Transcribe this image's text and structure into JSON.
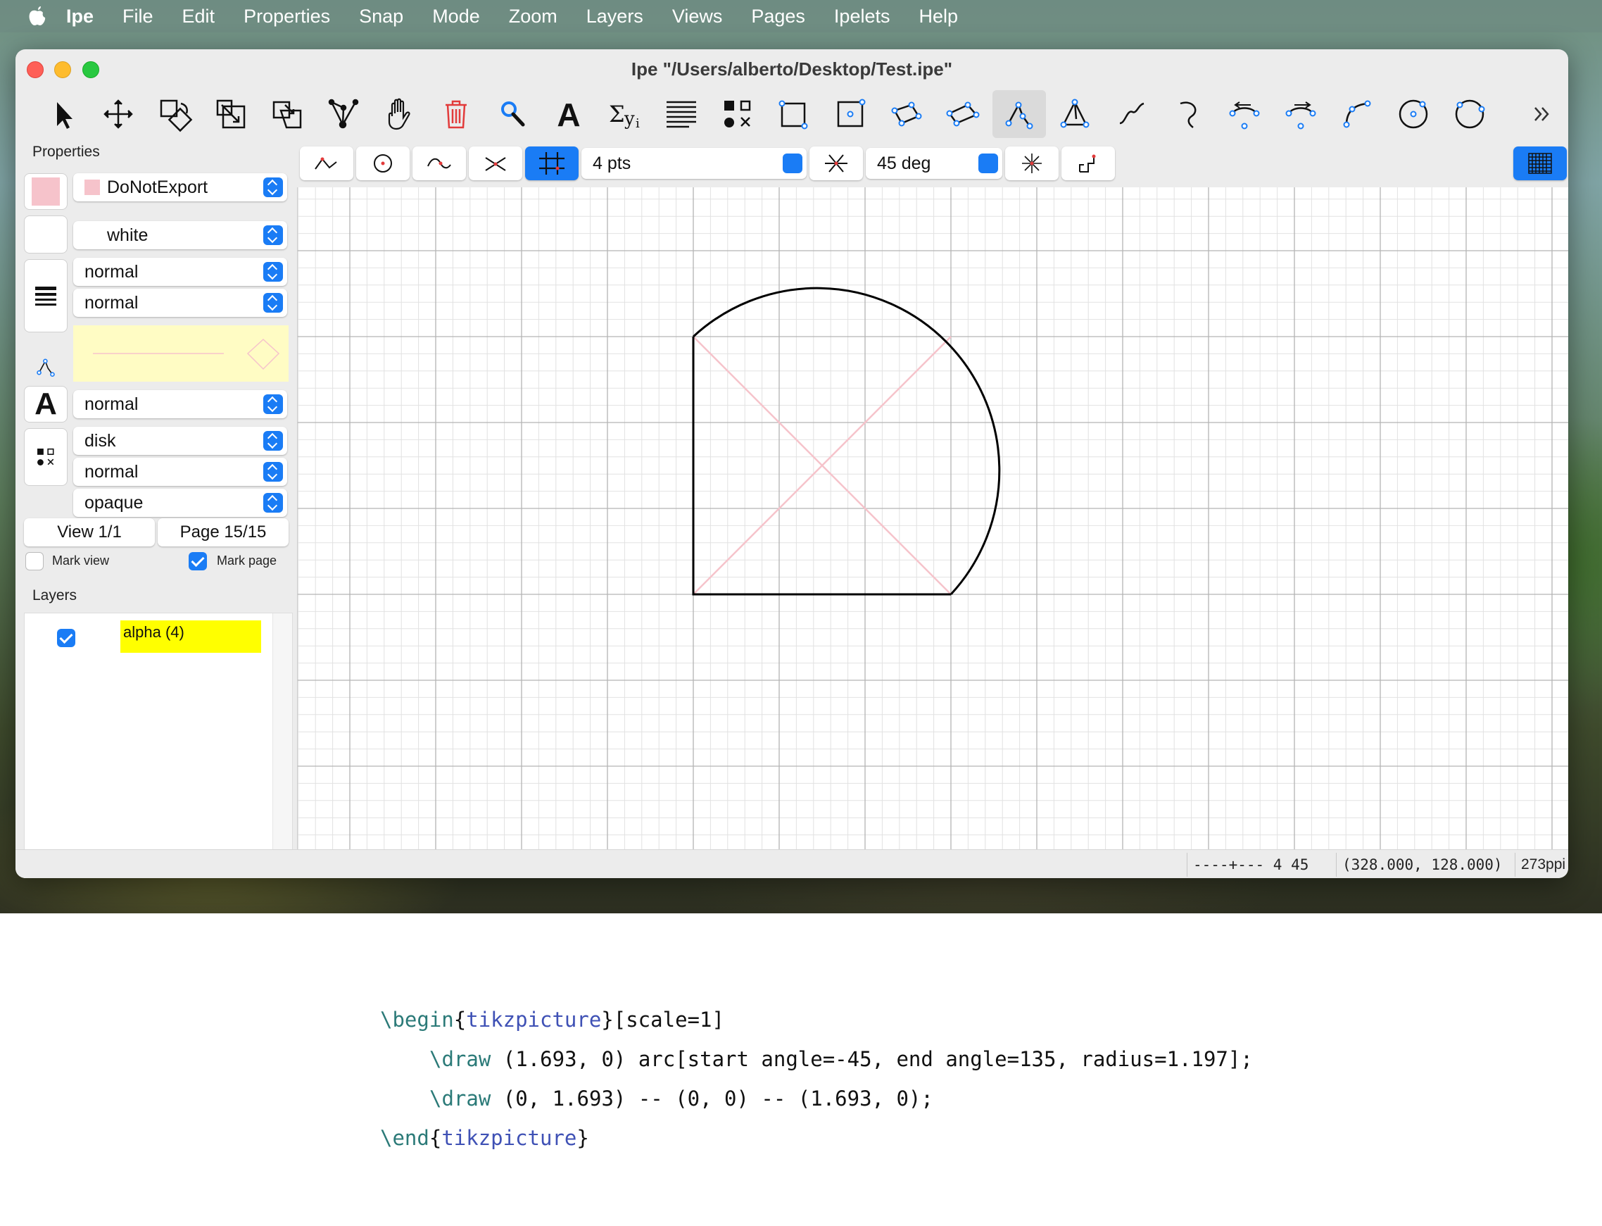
{
  "menubar": {
    "app": "Ipe",
    "items": [
      "File",
      "Edit",
      "Properties",
      "Snap",
      "Mode",
      "Zoom",
      "Layers",
      "Views",
      "Pages",
      "Ipelets",
      "Help"
    ]
  },
  "window": {
    "title": "Ipe \"/Users/alberto/Desktop/Test.ipe\""
  },
  "toolbar": {
    "tools": [
      "select-icon",
      "translate-icon",
      "rotate-icon",
      "stretch-icon",
      "shear-icon",
      "graph-icon",
      "pan-icon",
      "delete-icon",
      "magnify-icon",
      "text-label-icon",
      "math-formula-icon",
      "paragraph-icon",
      "marks-icon",
      "rectangle-icon",
      "box-icon",
      "parallelogram-icon",
      "splinegon-icon",
      "polyline-icon",
      "polygon-icon",
      "spline-icon",
      "bezier-icon",
      "arc-cw-icon",
      "arc-ccw-icon",
      "arc-3pt-icon",
      "circle-center-icon",
      "circle-3pt-icon",
      "more-icon"
    ],
    "active": "polyline-icon"
  },
  "properties": {
    "title": "Properties",
    "stroke": {
      "label": "DoNotExport",
      "color": "#f6c3cb"
    },
    "fill": {
      "label": "white",
      "color": "#ffffff"
    },
    "pen": "normal",
    "dash": "normal",
    "text_size": "normal",
    "mark_shape": "disk",
    "symbol_size": "normal",
    "opacity": "opaque",
    "view": "View 1/1",
    "page": "Page 15/15",
    "mark_view": {
      "label": "Mark view",
      "checked": false
    },
    "mark_page": {
      "label": "Mark page",
      "checked": true
    }
  },
  "layers": {
    "title": "Layers",
    "items": [
      {
        "name": "alpha (4)",
        "visible": true,
        "highlight": "#ffff00"
      }
    ]
  },
  "snap": {
    "grid_size": "4 pts",
    "angle": "45 deg",
    "grid_snap_on": true
  },
  "status": {
    "mode_indicator": "----+--- 4 45",
    "coords": "(328.000, 128.000)",
    "resolution": "273ppi"
  },
  "drawing": {
    "stroke_color": "#000000",
    "guide_color": "#f6c3cb"
  },
  "code": {
    "line1": {
      "cmd": "\\begin",
      "env": "tikzpicture",
      "rest": "[scale=1]"
    },
    "line2": {
      "cmd": "\\draw",
      "rest": " (1.693, 0) arc[start angle=-45, end angle=135, radius=1.197];"
    },
    "line3": {
      "cmd": "\\draw",
      "rest": " (0, 1.693) -- (0, 0) -- (1.693, 0);"
    },
    "line4": {
      "cmd": "\\end",
      "env": "tikzpicture"
    }
  }
}
